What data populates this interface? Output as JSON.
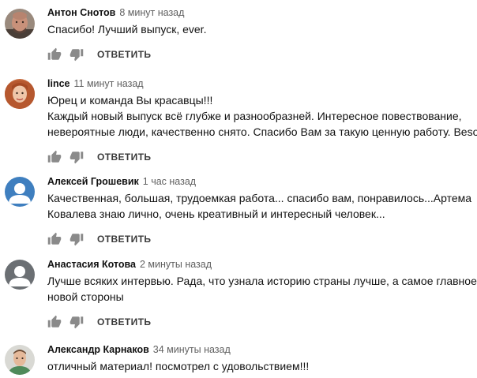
{
  "comments": [
    {
      "author": "Антон Снотов",
      "time": "8 минут назад",
      "lines": [
        "Спасибо! Лучший выпуск, ever."
      ],
      "reply": "ОТВЕТИТЬ",
      "avatar": "photo-man-bald"
    },
    {
      "author": "lince",
      "time": "11 минут назад",
      "lines": [
        "Юрец и команда Вы красавцы!!!",
        "Каждый новый выпуск всё глубже и разнообразней. Интересное повествование,",
        "невероятные люди, качественно снято. Спасибо Вам за такую ценную работу. Besos"
      ],
      "reply": "ОТВЕТИТЬ",
      "avatar": "photo-woman-red-hair"
    },
    {
      "author": "Алексей Грошевик",
      "time": "1 час назад",
      "lines": [
        "Качественная, большая, трудоемкая  работа... спасибо вам, понравилось...Артема",
        "Ковалева знаю лично, очень креативный и интересный человек..."
      ],
      "reply": "ОТВЕТИТЬ",
      "avatar": "default-user-blue"
    },
    {
      "author": "Анастасия Котова",
      "time": "2 минуты назад",
      "lines": [
        "Лучше всяких интервью. Рада, что узнала историю страны лучше, а самое главное-с",
        "новой стороны"
      ],
      "reply": "ОТВЕТИТЬ",
      "avatar": "default-user-gray"
    },
    {
      "author": "Александр Карнаков",
      "time": "34 минуты назад",
      "lines": [
        "отличный материал! посмотрел с удовольствием!!!"
      ],
      "reply": "ОТВЕТИТЬ",
      "avatar": "photo-man-green-shirt"
    }
  ],
  "icons": {
    "like": "thumb-up-icon",
    "dislike": "thumb-down-icon"
  },
  "colors": {
    "author": "#111111",
    "time": "#606060",
    "reply": "#3a3a3a",
    "icon": "#8a8a8a",
    "avatar_blue": "#3f7fbf",
    "avatar_gray": "#6b6f73"
  }
}
